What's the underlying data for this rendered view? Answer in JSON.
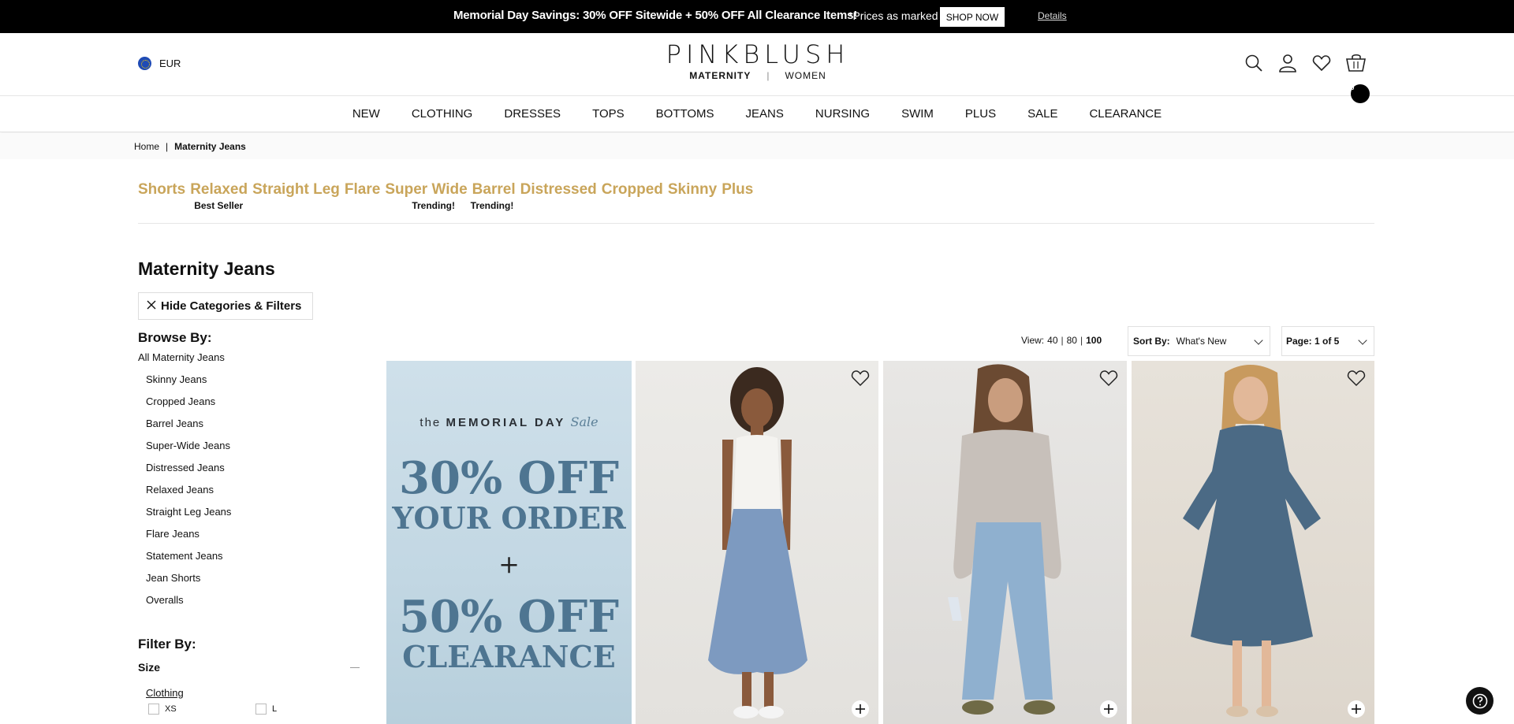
{
  "promo_bar": {
    "text": "Memorial Day Savings: 30% OFF Sitewide + 50% OFF All Clearance Items!",
    "note": "*Prices as marked",
    "shop_now": "SHOP NOW",
    "details": "Details"
  },
  "header": {
    "currency": "EUR",
    "logo": "PINKBLUSH",
    "logo_left": "MATERNITY",
    "logo_sep": "|",
    "logo_right": "WOMEN",
    "cart_count": "0"
  },
  "nav": [
    "NEW",
    "CLOTHING",
    "DRESSES",
    "TOPS",
    "BOTTOMS",
    "JEANS",
    "NURSING",
    "SWIM",
    "PLUS",
    "SALE",
    "CLEARANCE"
  ],
  "breadcrumb": {
    "home": "Home",
    "sep": "|",
    "current": "Maternity Jeans"
  },
  "quick_links": [
    {
      "label": "Shorts",
      "tag": ""
    },
    {
      "label": "Relaxed",
      "tag": "Best Seller"
    },
    {
      "label": "Straight Leg",
      "tag": ""
    },
    {
      "label": "Flare",
      "tag": ""
    },
    {
      "label": "Super Wide",
      "tag": "Trending!"
    },
    {
      "label": "Barrel",
      "tag": "Trending!"
    },
    {
      "label": "Distressed",
      "tag": ""
    },
    {
      "label": "Cropped",
      "tag": ""
    },
    {
      "label": "Skinny",
      "tag": ""
    },
    {
      "label": "Plus",
      "tag": ""
    }
  ],
  "page": {
    "title": "Maternity Jeans",
    "hide_filters": "Hide Categories & Filters",
    "browse_title": "Browse By:",
    "browse_all": "All Maternity Jeans",
    "browse_items": [
      "Skinny Jeans",
      "Cropped Jeans",
      "Barrel Jeans",
      "Super-Wide Jeans",
      "Distressed Jeans",
      "Relaxed Jeans",
      "Straight Leg Jeans",
      "Flare Jeans",
      "Statement Jeans",
      "Jean Shorts",
      "Overalls"
    ],
    "filter_title": "Filter By:",
    "size_label": "Size",
    "clothing_link": "Clothing",
    "size_options": [
      "XS",
      "L"
    ]
  },
  "toolbar": {
    "view_label": "View:",
    "view_options": [
      "40",
      "80",
      "100"
    ],
    "view_separator": "|",
    "view_selected": "100",
    "sort_label": "Sort By:",
    "sort_value": "What's New",
    "page_value": "Page: 1 of 5"
  },
  "promo_tile": {
    "line_the": "the",
    "line_event": "MEMORIAL DAY",
    "line_sale": "Sale",
    "off1": "30% OFF",
    "order": "YOUR ORDER",
    "plus": "+",
    "off2": "50% OFF",
    "clearance": "CLEARANCE"
  },
  "colors": {
    "promo_bg": "#000000",
    "accent_gold": "#c9a55a",
    "promo_tile_text": "#4e7591"
  }
}
